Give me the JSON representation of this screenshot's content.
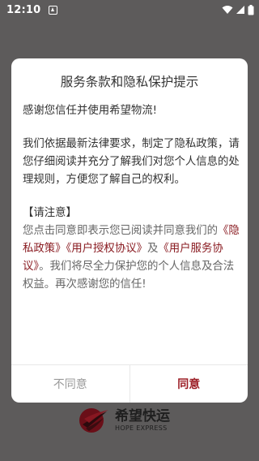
{
  "status_bar": {
    "time": "12:10"
  },
  "dialog": {
    "title": "服务条款和隐私保护提示",
    "p1": "感谢您信任并使用希望物流!",
    "p2": "我们依据最新法律要求，制定了隐私政策，请您仔细阅读并充分了解我们对您个人信息的处理规则，方便您了解自己的权利。",
    "notice_heading": "【请注意】",
    "notice_text_1": "您点击同意即表示您已阅读并同意我们的",
    "link_privacy": "《隐私政策》",
    "link_authorization": "《用户授权协议》",
    "and_text": "及",
    "link_service": "《用户服务协议》",
    "notice_text_2": "。我们将尽全力保护您的个人信息及合法权益。再次感谢您的信任!",
    "disagree_label": "不同意",
    "agree_label": "同意"
  },
  "brand": {
    "name": "希望快运",
    "subtitle": "HOPE EXPRESS"
  },
  "colors": {
    "accent": "#9b1c24",
    "link": "#8a1c22",
    "overlay": "#5d5b5b"
  },
  "icons": {
    "notification": "notification-a-icon",
    "wifi": "wifi-icon",
    "signal": "signal-icon",
    "battery": "battery-icon"
  }
}
